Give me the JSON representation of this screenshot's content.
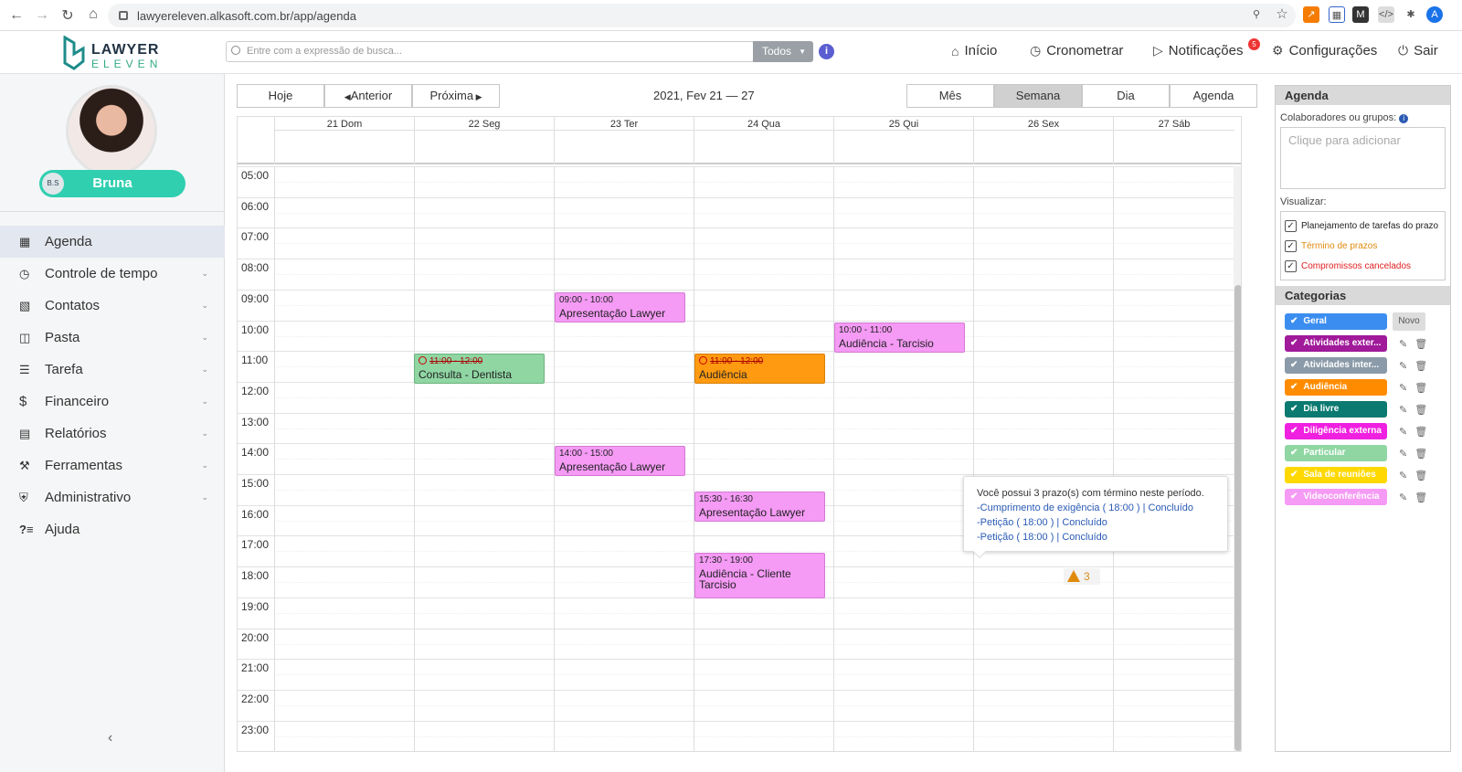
{
  "browser": {
    "url": "lawyereleven.alkasoft.com.br/app/agenda",
    "avatar_initial": "A"
  },
  "header": {
    "logo": {
      "line1": "LAWYER",
      "line2": "ELEVEN"
    },
    "search_placeholder": "Entre com a expressão de busca...",
    "scope": "Todos",
    "nav": [
      {
        "label": "Início",
        "icon": "home-icon"
      },
      {
        "label": "Cronometrar",
        "icon": "clock-icon"
      },
      {
        "label": "Notificações",
        "icon": "megaphone-icon"
      },
      {
        "label": "Configurações",
        "icon": "gear-icon"
      },
      {
        "label": "Sair",
        "icon": "power-icon"
      }
    ],
    "notification_count": "5"
  },
  "user": {
    "name": "Bruna",
    "initials": "B.S"
  },
  "sidebar": {
    "items": [
      {
        "label": "Agenda",
        "icon": "calendar-icon",
        "active": true
      },
      {
        "label": "Controle de tempo",
        "icon": "clock-icon",
        "expandable": true
      },
      {
        "label": "Contatos",
        "icon": "contacts-icon",
        "expandable": true
      },
      {
        "label": "Pasta",
        "icon": "folder-icon",
        "expandable": true
      },
      {
        "label": "Tarefa",
        "icon": "list-icon",
        "expandable": true
      },
      {
        "label": "Financeiro",
        "icon": "dollar-icon",
        "expandable": true
      },
      {
        "label": "Relatórios",
        "icon": "report-icon",
        "expandable": true
      },
      {
        "label": "Ferramentas",
        "icon": "wrench-icon",
        "expandable": true
      },
      {
        "label": "Administrativo",
        "icon": "shield-icon",
        "expandable": true
      },
      {
        "label": "Ajuda",
        "icon": "help-icon"
      }
    ]
  },
  "toolbar": {
    "today": "Hoje",
    "prev": "Anterior",
    "next": "Próxima",
    "range": "2021, Fev 21 — 27",
    "views": [
      "Mês",
      "Semana",
      "Dia",
      "Agenda"
    ],
    "active_view": "Semana"
  },
  "calendar": {
    "days": [
      "21 Dom",
      "22 Seg",
      "23 Ter",
      "24 Qua",
      "25 Qui",
      "26 Sex",
      "27 Sáb"
    ],
    "hours": [
      "05:00",
      "06:00",
      "07:00",
      "08:00",
      "09:00",
      "10:00",
      "11:00",
      "12:00",
      "13:00",
      "14:00",
      "15:00",
      "16:00",
      "17:00",
      "18:00",
      "19:00",
      "20:00",
      "21:00",
      "22:00",
      "23:00"
    ],
    "events": [
      {
        "time": "09:00 - 10:00",
        "title": "Apresentação Lawyer",
        "category": "Videoconferência"
      },
      {
        "time": "10:00 - 11:00",
        "title": "Audiência - Tarcisio",
        "category": "Videoconferência"
      },
      {
        "time": "11:00 - 12:00",
        "title": "Consulta - Dentista",
        "category": "Particular",
        "cancelled": true
      },
      {
        "time": "11:00 - 12:00",
        "title": "Audiência",
        "category": "Audiência",
        "cancelled": true
      },
      {
        "time": "14:00 - 15:00",
        "title": "Apresentação Lawyer",
        "category": "Videoconferência"
      },
      {
        "time": "15:30 - 16:30",
        "title": "Apresentação Lawyer",
        "category": "Videoconferência"
      },
      {
        "time": "17:30 - 19:00",
        "title": "Audiência - Cliente Tarcisio",
        "category": "Videoconferência"
      }
    ],
    "tooltip": {
      "intro": "Você possui 3 prazo(s) com término neste período.",
      "items": [
        "-Cumprimento de exigência ( 18:00 ) | Concluído",
        "-Petição ( 18:00 ) | Concluído",
        "-Petição ( 18:00 ) | Concluído"
      ]
    },
    "deadline_count": "3"
  },
  "right_panel": {
    "title": "Agenda",
    "collab_label": "Colaboradores ou grupos:",
    "collab_placeholder": "Clique para adicionar",
    "vis_label": "Visualizar:",
    "vis_options": [
      {
        "label": "Planejamento de tarefas do prazo",
        "color": "#222222"
      },
      {
        "label": "Término de prazos",
        "color": "#e08a0d"
      },
      {
        "label": "Compromissos cancelados",
        "color": "#e02020"
      }
    ],
    "cat_title": "Categorias",
    "new_label": "Novo",
    "categories": [
      {
        "label": "Geral",
        "color": "#3b8ef0"
      },
      {
        "label": "Atividades exter...",
        "color": "#a01a9a"
      },
      {
        "label": "Atividades inter...",
        "color": "#8a9aa8"
      },
      {
        "label": "Audiência",
        "color": "#ff8c00"
      },
      {
        "label": "Dia livre",
        "color": "#0b7a70"
      },
      {
        "label": "Diligência externa",
        "color": "#f020e0"
      },
      {
        "label": "Particular",
        "color": "#8fd6a3"
      },
      {
        "label": "Sala de reuniões",
        "color": "#ffd800"
      },
      {
        "label": "Videoconferência",
        "color": "#f59af5"
      }
    ]
  }
}
